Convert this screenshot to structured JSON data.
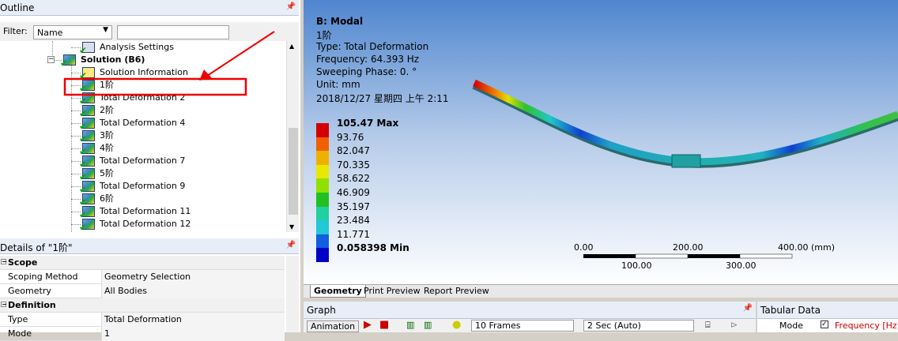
{
  "outline": {
    "title": "Outline",
    "filter_label": "Filter:",
    "filter_value": "Name",
    "tree": [
      {
        "label": "Analysis Settings",
        "level": 2,
        "icon": "analysis-settings-icon"
      },
      {
        "label": "Solution (B6)",
        "level": 1,
        "icon": "solution-icon"
      },
      {
        "label": "Solution Information",
        "level": 2,
        "icon": "info-icon"
      },
      {
        "label": "1阶",
        "level": 2,
        "icon": "deformation-icon"
      },
      {
        "label": "Total Deformation 2",
        "level": 2,
        "icon": "deformation-icon"
      },
      {
        "label": "2阶",
        "level": 2,
        "icon": "deformation-icon"
      },
      {
        "label": "Total Deformation 4",
        "level": 2,
        "icon": "deformation-icon"
      },
      {
        "label": "3阶",
        "level": 2,
        "icon": "deformation-icon"
      },
      {
        "label": "4阶",
        "level": 2,
        "icon": "deformation-icon"
      },
      {
        "label": "Total Deformation 7",
        "level": 2,
        "icon": "deformation-icon"
      },
      {
        "label": "5阶",
        "level": 2,
        "icon": "deformation-icon"
      },
      {
        "label": "Total Deformation 9",
        "level": 2,
        "icon": "deformation-icon"
      },
      {
        "label": "6阶",
        "level": 2,
        "icon": "deformation-icon"
      },
      {
        "label": "Total Deformation 11",
        "level": 2,
        "icon": "deformation-icon"
      },
      {
        "label": "Total Deformation 12",
        "level": 2,
        "icon": "deformation-icon"
      }
    ]
  },
  "details": {
    "title": "Details of \"1阶\"",
    "rows": [
      {
        "section": "Scope"
      },
      {
        "key": "Scoping Method",
        "value": "Geometry Selection"
      },
      {
        "key": "Geometry",
        "value": "All Bodies"
      },
      {
        "section": "Definition"
      },
      {
        "key": "Type",
        "value": "Total Deformation"
      },
      {
        "key": "Mode",
        "value": "1"
      }
    ]
  },
  "viewport": {
    "header": [
      "B: Modal",
      "1阶",
      "Type: Total Deformation",
      "Frequency: 64.393 Hz",
      "Sweeping Phase: 0. °",
      "Unit: mm",
      "2018/12/27 星期四 上午 2:11"
    ],
    "legend": [
      {
        "label": "105.47 Max",
        "color": "#d40000",
        "bold": true
      },
      {
        "label": "93.76",
        "color": "#f06000"
      },
      {
        "label": "82.047",
        "color": "#f0b000"
      },
      {
        "label": "70.335",
        "color": "#e8e800"
      },
      {
        "label": "58.622",
        "color": "#90e000"
      },
      {
        "label": "46.909",
        "color": "#20c020"
      },
      {
        "label": "35.197",
        "color": "#20d0a0"
      },
      {
        "label": "23.484",
        "color": "#20c8d8"
      },
      {
        "label": "11.771",
        "color": "#1060e0"
      },
      {
        "label": "0.058398 Min",
        "color": "#0000c8",
        "bold": true
      }
    ],
    "scale": {
      "top": [
        "0.00",
        "200.00",
        "400.00 (mm)"
      ],
      "bottom": [
        "100.00",
        "300.00"
      ]
    }
  },
  "tabs": [
    "Geometry",
    "Print Preview",
    "Report Preview"
  ],
  "graph": {
    "title": "Graph",
    "animation_label": "Animation",
    "frames": "10 Frames",
    "duration": "2 Sec (Auto)"
  },
  "tabular": {
    "title": "Tabular Data",
    "mode_col": "Mode",
    "freq_col": "Frequency [Hz]"
  }
}
